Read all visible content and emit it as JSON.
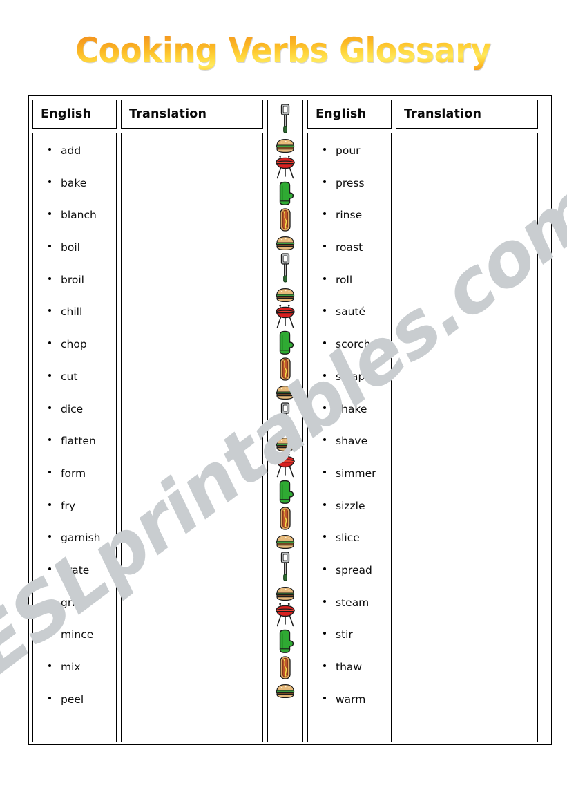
{
  "page": {
    "title": "Cooking Verbs Glossary",
    "watermark": "ESLprintables.com",
    "title_gradient_from": "#f28c1e",
    "title_gradient_to": "#ffe95e"
  },
  "table": {
    "headers": {
      "english_left": "English",
      "translation_left": "Translation",
      "english_right": "English",
      "translation_right": "Translation"
    },
    "left_words": [
      "add",
      "bake",
      "blanch",
      "boil",
      "broil",
      "chill",
      "chop",
      "cut",
      "dice",
      "flatten",
      "form",
      "fry",
      "garnish",
      "grate",
      "grill",
      "mince",
      "mix",
      "peel"
    ],
    "right_words": [
      "pour",
      "press",
      "rinse",
      "roast",
      "roll",
      "sauté",
      "scorch",
      "scrape",
      "shake",
      "shave",
      "simmer",
      "sizzle",
      "slice",
      "spread",
      "steam",
      "stir",
      "thaw",
      "warm"
    ],
    "left_translations": [],
    "right_translations": []
  },
  "picture_strip": {
    "icons": [
      "spatula-icon",
      "hamburger-icon",
      "bbq-grill-icon",
      "oven-mitt-icon",
      "hot-dog-icon",
      "hamburger-icon",
      "spatula-icon",
      "hamburger-icon",
      "bbq-grill-icon",
      "oven-mitt-icon",
      "hot-dog-icon",
      "hamburger-icon",
      "spatula-icon",
      "hamburger-icon",
      "bbq-grill-icon",
      "oven-mitt-icon",
      "hot-dog-icon",
      "hamburger-icon",
      "spatula-icon",
      "hamburger-icon",
      "bbq-grill-icon",
      "oven-mitt-icon",
      "hot-dog-icon",
      "hamburger-icon"
    ],
    "colors": {
      "spatula_blade": "#b9bcbe",
      "spatula_handle": "#2f6b33",
      "bun": "#e6b97a",
      "patty": "#7a4a24",
      "lettuce": "#3f9b3f",
      "grill_body": "#d8201f",
      "mitt": "#2faa33",
      "hotdog_bun": "#dfa863",
      "sausage": "#c0552b"
    }
  }
}
